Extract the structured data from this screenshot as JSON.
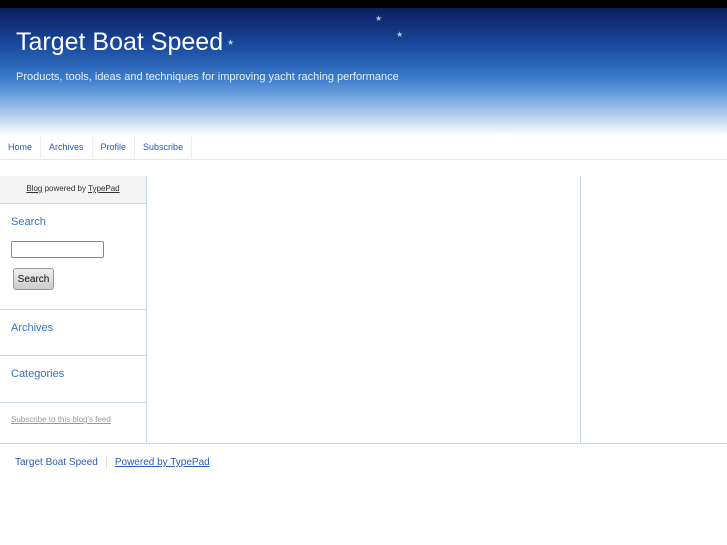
{
  "header": {
    "title": "Target Boat Speed",
    "description": "Products, tools, ideas and techniques for improving yacht raching performance"
  },
  "nav": [
    "Home",
    "Archives",
    "Profile",
    "Subscribe"
  ],
  "sidebar": {
    "powered_blog": "Blog",
    "powered_mid": " powered by ",
    "powered_typepad": "TypePad",
    "search_heading": "Search",
    "search_button": "Search",
    "search_value": "",
    "archives": "Archives",
    "categories": "Categories",
    "feed": "Subscribe to this blog's feed"
  },
  "footer": {
    "site": "Target Boat Speed",
    "powered": "Powered by TypePad"
  }
}
